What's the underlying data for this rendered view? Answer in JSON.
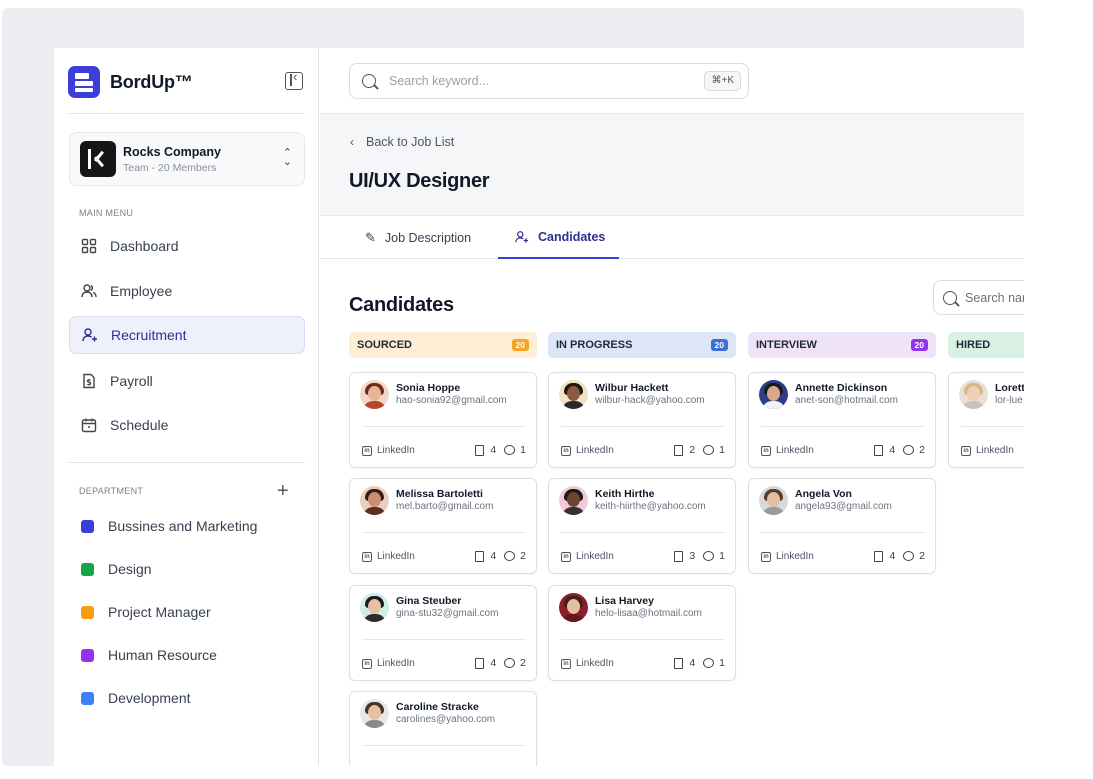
{
  "brand": {
    "name": "BordUp™"
  },
  "company": {
    "name": "Rocks Company",
    "subtitle": "Team - 20 Members"
  },
  "sidebar": {
    "main_menu_label": "MAIN MENU",
    "items": [
      {
        "label": "Dashboard",
        "icon": "grid-icon"
      },
      {
        "label": "Employee",
        "icon": "users-icon"
      },
      {
        "label": "Recruitment",
        "icon": "user-plus-icon",
        "active": true
      },
      {
        "label": "Payroll",
        "icon": "file-dollar-icon"
      },
      {
        "label": "Schedule",
        "icon": "calendar-icon"
      }
    ],
    "department_label": "DEPARTMENT",
    "departments": [
      {
        "label": "Bussines and Marketing",
        "color": "#3b3fd8"
      },
      {
        "label": "Design",
        "color": "#16a34a"
      },
      {
        "label": "Project Manager",
        "color": "#f59e0b"
      },
      {
        "label": "Human Resource",
        "color": "#9333ea"
      },
      {
        "label": "Development",
        "color": "#3b82f6"
      }
    ]
  },
  "search": {
    "placeholder": "Search keyword...",
    "shortcut": "⌘+K"
  },
  "header": {
    "back_label": "Back to Job List",
    "title": "UI/UX Designer"
  },
  "tabs": [
    {
      "label": "Job Description",
      "icon": "pencil-icon"
    },
    {
      "label": "Candidates",
      "icon": "user-plus-icon",
      "active": true
    }
  ],
  "candidates": {
    "title": "Candidates",
    "search_placeholder": "Search name",
    "columns": [
      {
        "title": "SOURCED",
        "count": "20",
        "bg": "#fdeed5",
        "badge": "#f4a524",
        "cards": [
          {
            "name": "Sonia Hoppe",
            "email": "hao-sonia92@gmail.com",
            "source": "LinkedIn",
            "docs": "4",
            "comments": "1"
          },
          {
            "name": "Melissa Bartoletti",
            "email": "mel.barto@gmail.com",
            "source": "LinkedIn",
            "docs": "4",
            "comments": "2"
          },
          {
            "name": "Gina Steuber",
            "email": "gina-stu32@gmail.com",
            "source": "LinkedIn",
            "docs": "4",
            "comments": "2"
          },
          {
            "name": "Caroline Stracke",
            "email": "carolines@yahoo.com",
            "source": "",
            "docs": "",
            "comments": ""
          }
        ]
      },
      {
        "title": "IN PROGRESS",
        "count": "20",
        "bg": "#dde6f6",
        "badge": "#3b6fd8",
        "cards": [
          {
            "name": "Wilbur Hackett",
            "email": "wilbur-hack@yahoo.com",
            "source": "LinkedIn",
            "docs": "2",
            "comments": "1"
          },
          {
            "name": "Keith Hirthe",
            "email": "keith-hiirthe@yahoo.com",
            "source": "LinkedIn",
            "docs": "3",
            "comments": "1"
          },
          {
            "name": "Lisa Harvey",
            "email": "helo-lisaa@hotmail.com",
            "source": "LinkedIn",
            "docs": "4",
            "comments": "1"
          }
        ]
      },
      {
        "title": "INTERVIEW",
        "count": "20",
        "bg": "#efe3fa",
        "badge": "#9333ea",
        "cards": [
          {
            "name": "Annette Dickinson",
            "email": "anet-son@hotmail.com",
            "source": "LinkedIn",
            "docs": "4",
            "comments": "2"
          },
          {
            "name": "Angela Von",
            "email": "angela93@gmail.com",
            "source": "LinkedIn",
            "docs": "4",
            "comments": "2"
          }
        ]
      },
      {
        "title": "HIRED",
        "count": "",
        "bg": "#d8f1e3",
        "badge": "#16a34a",
        "cards": [
          {
            "name": "Loretta",
            "email": "lor-lue",
            "source": "LinkedIn",
            "docs": "",
            "comments": ""
          }
        ]
      }
    ]
  }
}
